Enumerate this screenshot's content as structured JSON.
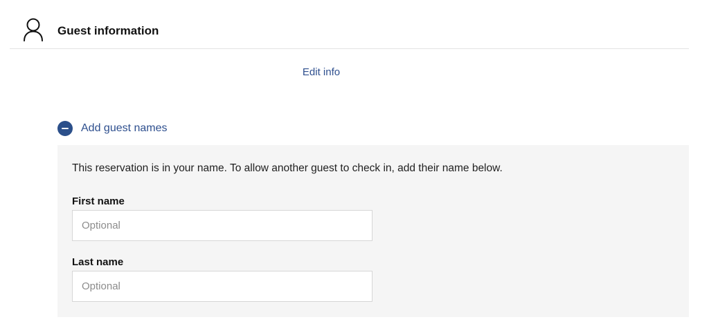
{
  "header": {
    "icon": "person-icon",
    "title": "Guest information"
  },
  "edit_link": "Edit info",
  "guest_names": {
    "toggle_icon": "minus-circle-icon",
    "toggle_label": "Add guest names",
    "note": "This reservation is in your name. To allow another guest to check in, add their name below.",
    "fields": [
      {
        "label": "First name",
        "value": "",
        "placeholder": "Optional"
      },
      {
        "label": "Last name",
        "value": "",
        "placeholder": "Optional"
      }
    ]
  },
  "colors": {
    "accent": "#2e4f8e",
    "panel_background": "#f5f5f5",
    "divider": "#e3e3e3"
  }
}
